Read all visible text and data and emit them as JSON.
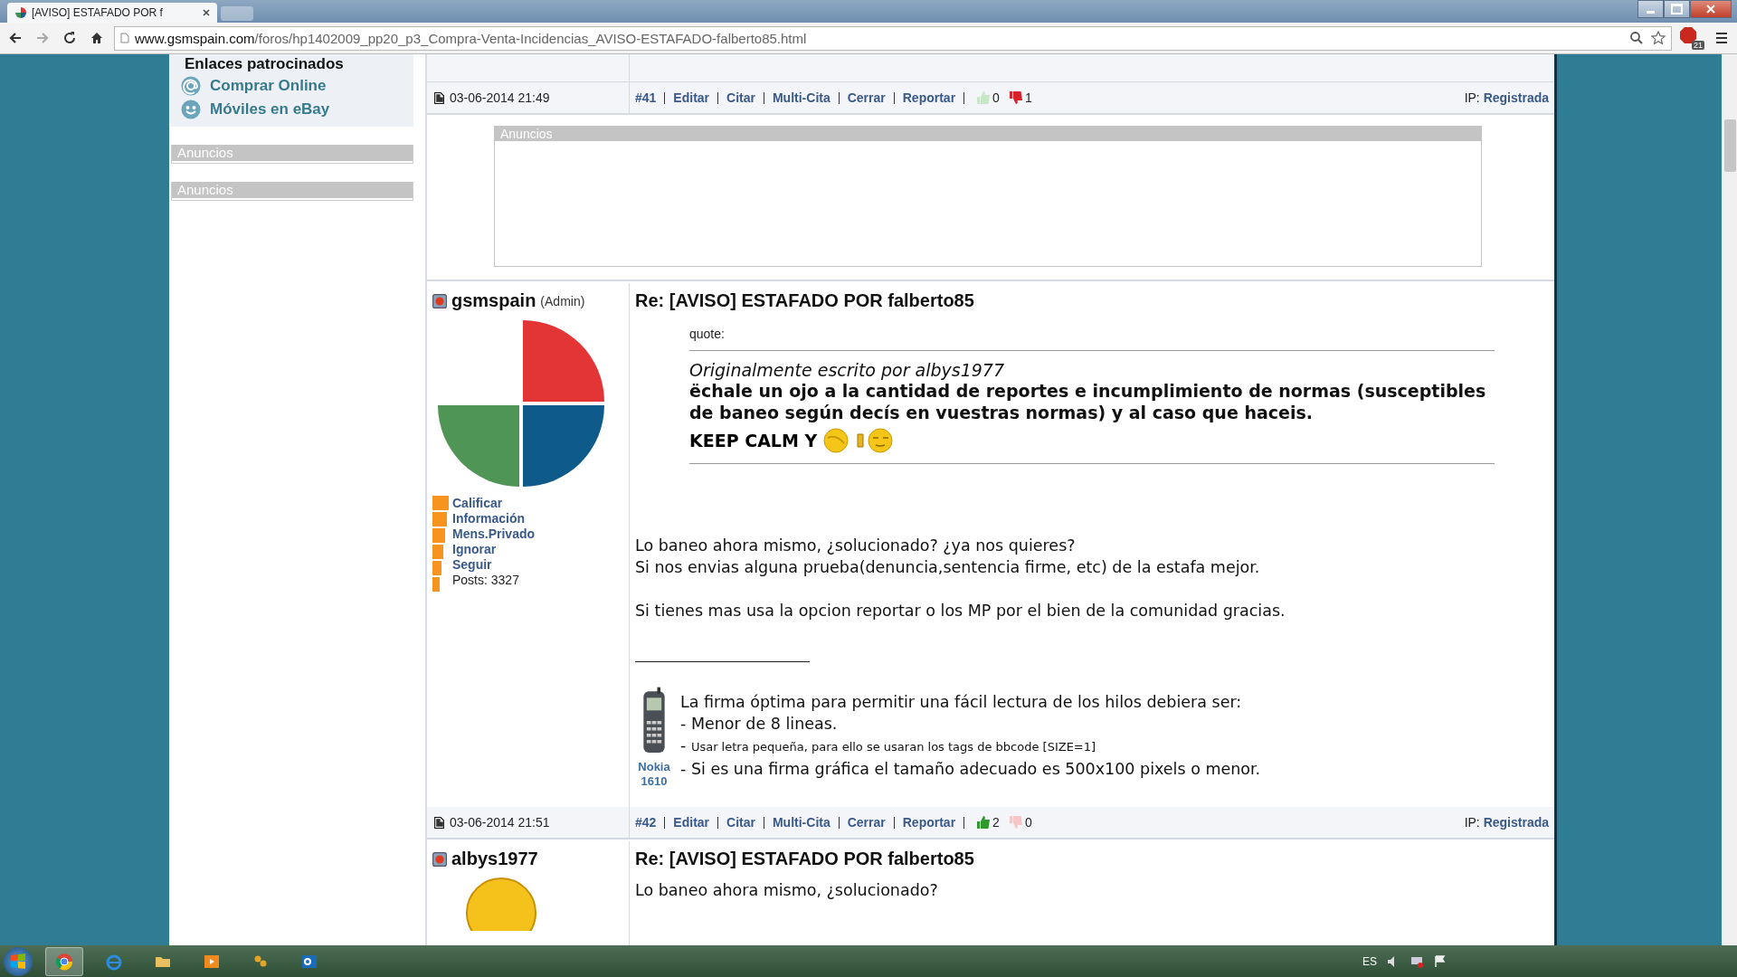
{
  "browser": {
    "tab_title": "[AVISO] ESTAFADO POR f",
    "url_host": "www.gsmspain.com",
    "url_path": "/foros/hp1402009_pp20_p3_Compra-Venta-Incidencias_AVISO-ESTAFADO-falberto85.html",
    "extension_badge": "21"
  },
  "sidebar": {
    "title": "Enlaces patrocinados",
    "links": [
      {
        "kind": "at",
        "label": "Comprar Online"
      },
      {
        "kind": "smiley",
        "label": "Móviles en eBay"
      }
    ],
    "ad_boxes": [
      "Anuncios",
      "Anuncios"
    ]
  },
  "thread": [
    {
      "kind": "footer",
      "date": "03-06-2014 21:49",
      "number": "#41",
      "actions": [
        "Editar",
        "Citar",
        "Multi-Cita",
        "Cerrar",
        "Reportar"
      ],
      "up": {
        "count": "0",
        "active": false
      },
      "down": {
        "count": "1",
        "active": true
      },
      "ip_label": "IP:",
      "ip_value": "Registrada"
    },
    {
      "kind": "ad",
      "title": "Anuncios"
    },
    {
      "kind": "post",
      "author": "gsmspain",
      "role": "(Admin)",
      "avatar": {
        "kind": "quarters"
      },
      "menu": [
        "Calificar",
        "Información",
        "Mens.Privado",
        "Ignorar",
        "Seguir"
      ],
      "posts_count": "Posts: 3327",
      "title": "Re: [AVISO] ESTAFADO POR falberto85",
      "quote": {
        "label": "quote:",
        "attribution": "Originalmente escrito por albys1977",
        "text": "ëchale un ojo a la cantidad de reportes e incumplimiento de normas (susceptibles de baneo según decís en vuestras normas) y al caso que haceis.",
        "keep_calm": "KEEP CALM Y"
      },
      "paragraphs": [
        [
          "Lo baneo ahora mismo, ¿solucionado? ¿ya nos quieres?",
          "Si nos envias alguna prueba(denuncia,sentencia firme, etc) de la estafa mejor."
        ],
        [
          "Si tienes mas usa la opcion reportar o los MP por el bien de la comunidad gracias."
        ]
      ],
      "signature": {
        "phone_label": [
          "Nokia",
          "1610"
        ],
        "lines": [
          {
            "text": "La firma óptima para permitir una fácil lectura de los hilos debiera ser:",
            "small": false
          },
          {
            "bullet": "-",
            "text": "Menor de 8 lineas.",
            "small": false
          },
          {
            "bullet": "-",
            "text": "Usar letra pequeña, para ello se usaran los tags de bbcode [SIZE=1]",
            "small": true
          },
          {
            "bullet": "-",
            "text": "Si es una firma gráfica el tamaño adecuado es 500x100 pixels o menor.",
            "small": false
          }
        ]
      }
    },
    {
      "kind": "footer",
      "date": "03-06-2014 21:51",
      "number": "#42",
      "actions": [
        "Editar",
        "Citar",
        "Multi-Cita",
        "Cerrar",
        "Reportar"
      ],
      "up": {
        "count": "2",
        "active": true
      },
      "down": {
        "count": "0",
        "active": false
      },
      "ip_label": "IP:",
      "ip_value": "Registrada"
    },
    {
      "kind": "post",
      "author": "albys1977",
      "avatar": {
        "kind": "face"
      },
      "title": "Re: [AVISO] ESTAFADO POR falberto85",
      "paragraphs": [
        [
          "Lo baneo ahora mismo, ¿solucionado?"
        ]
      ]
    }
  ],
  "taskbar": {
    "language": "ES"
  }
}
